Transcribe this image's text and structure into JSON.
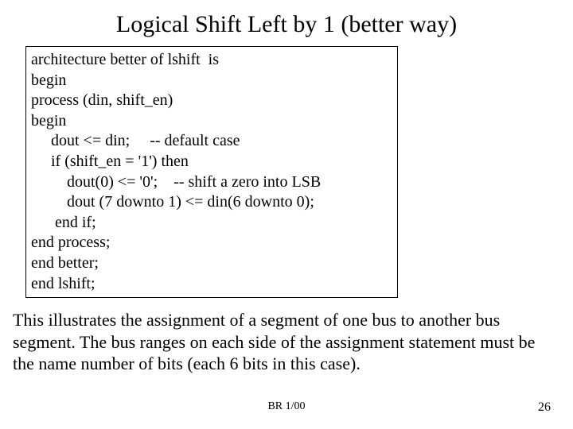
{
  "title": "Logical Shift Left by 1 (better way)",
  "code": {
    "l1": "architecture better of lshift  is",
    "l2": "begin",
    "l3": "process (din, shift_en) ",
    "l4": "begin ",
    "l5": "     dout <= din;     -- default case   ",
    "l6": "     if (shift_en = '1') then ",
    "l7": "         dout(0) <= '0';    -- shift a zero into LSB",
    "l8": "         dout (7 downto 1) <= din(6 downto 0);",
    "l9": "      end if; ",
    "l10": "end process; ",
    "l11": "end better;",
    "l12": "end lshift;"
  },
  "body": "This illustrates the assignment of a segment of one bus to another bus segment. The bus ranges on each side of the assignment statement must be the name number of bits (each 6 bits in this case).",
  "footer_center": "BR 1/00",
  "footer_right": "26"
}
